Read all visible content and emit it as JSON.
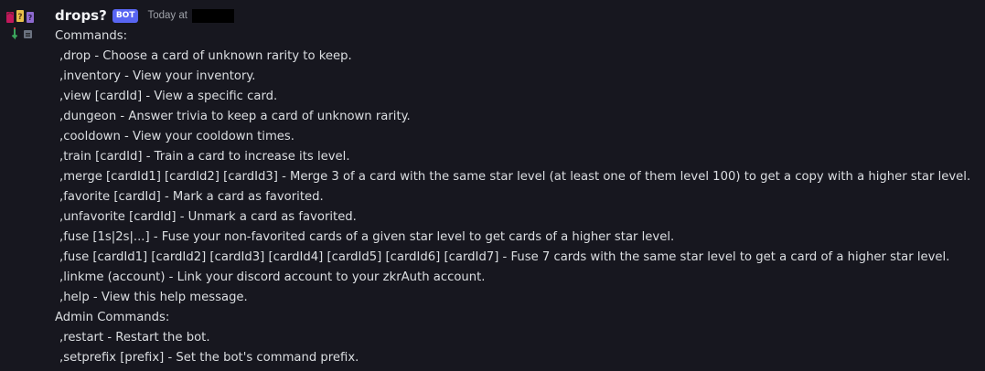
{
  "message": {
    "author": "drops?",
    "badge": "BOT",
    "timestamp": "Today at",
    "commands_heading": "Commands:",
    "commands": [
      ",drop - Choose a card of unknown rarity to keep.",
      ",inventory - View your inventory.",
      ",view [cardId] - View a specific card.",
      ",dungeon - Answer trivia to keep a card of unknown rarity.",
      ",cooldown - View your cooldown times.",
      ",train [cardId] - Train a card to increase its level.",
      ",merge [cardId1] [cardId2] [cardId3] - Merge 3 of a card with the same star level (at least one of them level 100) to get a copy with a higher star level.",
      ",favorite [cardId] - Mark a card as favorited.",
      ",unfavorite [cardId] - Unmark a card as favorited.",
      ",fuse [1s|2s|...] - Fuse your non-favorited cards of a given star level to get cards of a higher star level.",
      ",fuse [cardId1] [cardId2] [cardId3] [cardId4] [cardId5] [cardId6] [cardId7] - Fuse 7 cards with the same star level to get a card of a higher star level.",
      ",linkme (account) - Link your discord account to your zkrAuth account.",
      ",help - View this help message."
    ],
    "admin_heading": "Admin Commands:",
    "admin_commands": [
      ",restart - Restart the bot.",
      ",setprefix [prefix] - Set the bot's command prefix."
    ]
  },
  "icons": {
    "avatar": "drops-bot-avatar-icon"
  },
  "colors": {
    "background": "#17171f",
    "text": "#dbdee1",
    "username": "#f2f3f5",
    "bot_badge": "#5865f2",
    "timestamp": "#a0a3aa"
  }
}
